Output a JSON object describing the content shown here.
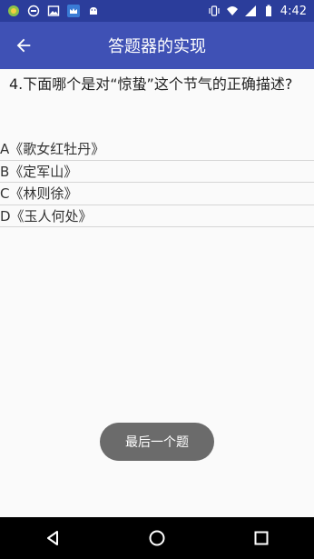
{
  "status_bar": {
    "time": "4:42",
    "left_icons": [
      "green-app-icon",
      "notification-icon",
      "image-icon",
      "crown-icon",
      "android-icon"
    ],
    "right_icons": [
      "vibrate-icon",
      "wifi-icon",
      "signal-icon",
      "battery-icon"
    ]
  },
  "app_bar": {
    "title": "答题器的实现",
    "back_icon": "arrow-left-icon"
  },
  "question": {
    "text": "4.下面哪个是对“惊蛰”这个节气的正确描述?"
  },
  "options": [
    {
      "label": "A《歌女红牡丹》"
    },
    {
      "label": "B《定军山》"
    },
    {
      "label": "C《林则徐》"
    },
    {
      "label": "D《玉人何处》"
    }
  ],
  "toast": {
    "text": "最后一个题"
  },
  "nav_bar": {
    "back_icon": "triangle-back-icon",
    "home_icon": "circle-home-icon",
    "recents_icon": "square-recents-icon"
  },
  "colors": {
    "status_bar": "#2b3d9b",
    "app_bar": "#3f51b5",
    "toast": "#6b6b6b",
    "nav_bar": "#000000"
  }
}
